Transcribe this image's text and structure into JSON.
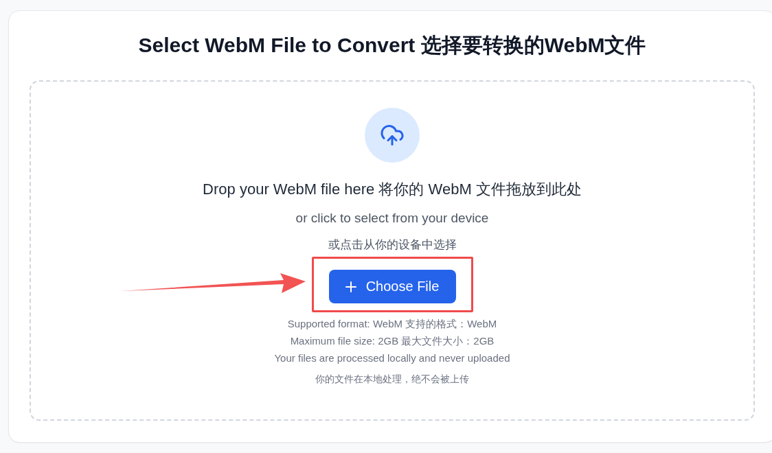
{
  "title": "Select WebM File to Convert 选择要转换的WebM文件",
  "dropzone": {
    "heading": "Drop your WebM file here 将你的 WebM 文件拖放到此处",
    "subtext": "or click to select from your device",
    "subtext_zh": "或点击从你的设备中选择",
    "button": {
      "label": "Choose File"
    },
    "notes": [
      "Supported format: WebM 支持的格式：WebM",
      "Maximum file size: 2GB 最大文件大小：2GB",
      "Your files are processed locally and never uploaded",
      "你的文件在本地处理，绝不会被上传"
    ]
  },
  "callout": {
    "arrow": true,
    "frame": true
  }
}
